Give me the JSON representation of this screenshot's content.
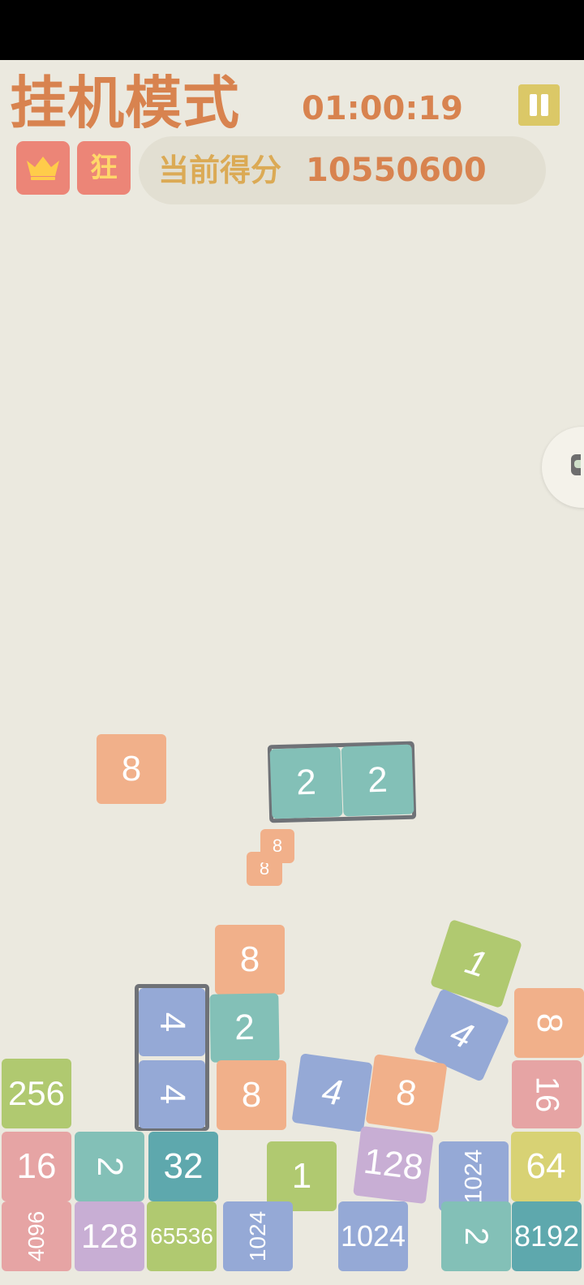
{
  "header": {
    "mode_title": "挂机模式",
    "timer": "01:00:19",
    "score_label": "当前得分",
    "score_value": "10550600",
    "crazy_label": "狂",
    "icons": {
      "pause": "pause-icon",
      "crown": "crown-icon",
      "side": "side-panel-icon"
    }
  },
  "colors": {
    "background": "#ebe9df",
    "accent_orange": "#d8834f",
    "accent_gold": "#dbaa55",
    "pause_button": "#dbc867",
    "badge_red": "#ec8577",
    "tile_2": "#83c0b7",
    "tile_4": "#95a9d6",
    "tile_8": "#f1b08a",
    "tile_16": "#e6a4a4",
    "tile_32": "#5ea8ad",
    "tile_64": "#d8d274",
    "tile_128": "#c8aed4",
    "tile_256": "#b0c970",
    "tile_1024": "#95a9d6",
    "tile_8192": "#5ea8ad",
    "tile_65536": "#b0c970",
    "tile_1": "#b0c970"
  },
  "tiles": [
    {
      "label": "8",
      "cls": "tile_8"
    },
    {
      "label": "2",
      "cls": "tile_2"
    },
    {
      "label": "2",
      "cls": "tile_2"
    },
    {
      "label": "8",
      "cls": "tile_8"
    },
    {
      "label": "8",
      "cls": "tile_8"
    },
    {
      "label": "8",
      "cls": "tile_8"
    },
    {
      "label": "1",
      "cls": "tile_1"
    },
    {
      "label": "4",
      "cls": "tile_4"
    },
    {
      "label": "2",
      "cls": "tile_2"
    },
    {
      "label": "4",
      "cls": "tile_4"
    },
    {
      "label": "8",
      "cls": "tile_8"
    },
    {
      "label": "4",
      "cls": "tile_4"
    },
    {
      "label": "8",
      "cls": "tile_8"
    },
    {
      "label": "4",
      "cls": "tile_4"
    },
    {
      "label": "8",
      "cls": "tile_8"
    },
    {
      "label": "16",
      "cls": "tile_16"
    },
    {
      "label": "256",
      "cls": "tile_256"
    },
    {
      "label": "16",
      "cls": "tile_16"
    },
    {
      "label": "2",
      "cls": "tile_2"
    },
    {
      "label": "32",
      "cls": "tile_32"
    },
    {
      "label": "1",
      "cls": "tile_1"
    },
    {
      "label": "128",
      "cls": "tile_128"
    },
    {
      "label": "1024",
      "cls": "tile_1024"
    },
    {
      "label": "64",
      "cls": "tile_64"
    },
    {
      "label": "4096",
      "cls": "tile_16"
    },
    {
      "label": "128",
      "cls": "tile_128"
    },
    {
      "label": "65536",
      "cls": "tile_65536"
    },
    {
      "label": "1024",
      "cls": "tile_1024"
    },
    {
      "label": "1024",
      "cls": "tile_1024"
    },
    {
      "label": "2",
      "cls": "tile_2"
    },
    {
      "label": "8192",
      "cls": "tile_8192"
    }
  ]
}
